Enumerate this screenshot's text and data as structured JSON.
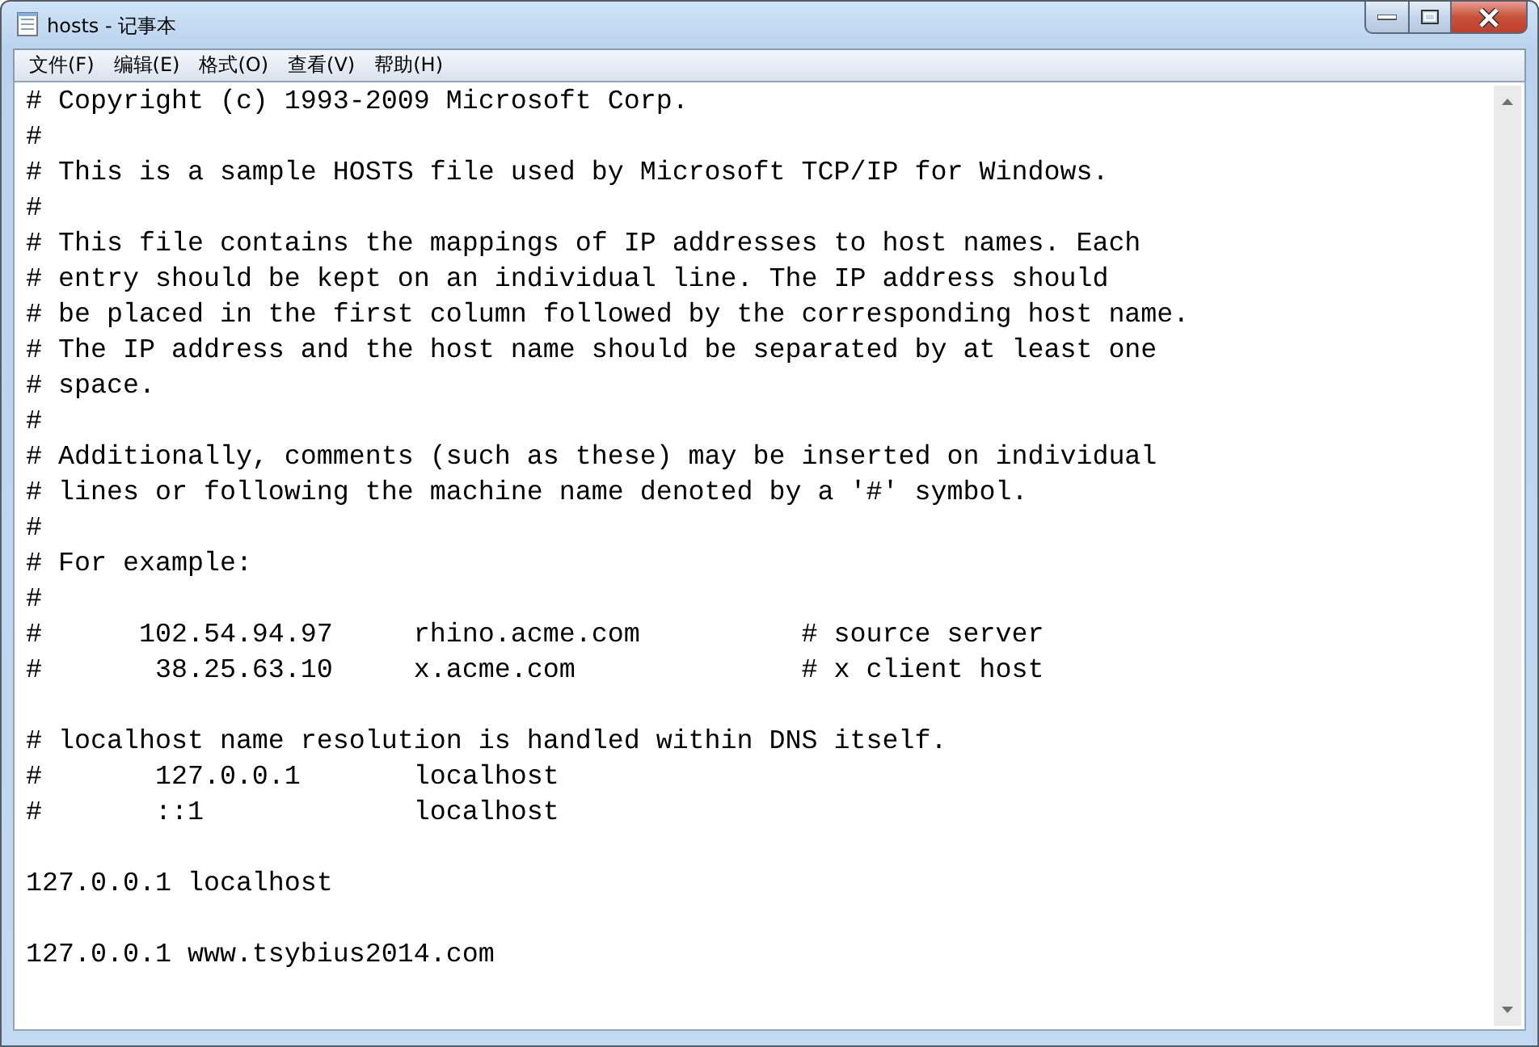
{
  "window": {
    "title": "hosts - 记事本"
  },
  "menu": [
    "文件(F)",
    "编辑(E)",
    "格式(O)",
    "查看(V)",
    "帮助(H)"
  ],
  "editor": {
    "blocks": [
      [
        "# Copyright (c) 1993-2009 Microsoft Corp.",
        "#",
        "# This is a sample HOSTS file used by Microsoft TCP/IP for Windows.",
        "#",
        "# This file contains the mappings of IP addresses to host names. Each",
        "# entry should be kept on an individual line. The IP address should",
        "# be placed in the first column followed by the corresponding host name.",
        "# The IP address and the host name should be separated by at least one",
        "# space.",
        "#",
        "# Additionally, comments (such as these) may be inserted on individual",
        "# lines or following the machine name denoted by a '#' symbol.",
        "#",
        "# For example:",
        "#",
        "#      102.54.94.97     rhino.acme.com          # source server",
        "#       38.25.63.10     x.acme.com              # x client host"
      ],
      [
        "# localhost name resolution is handled within DNS itself.",
        "#       127.0.0.1       localhost",
        "#       ::1             localhost"
      ],
      [
        "127.0.0.1 localhost"
      ],
      [
        "127.0.0.1 www.tsybius2014.com"
      ]
    ]
  }
}
